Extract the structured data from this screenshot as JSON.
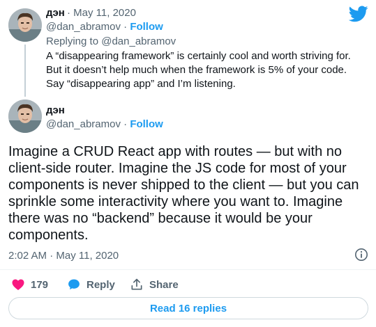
{
  "colors": {
    "accent": "#1d9bf0",
    "muted": "#536471",
    "text": "#0f1419",
    "like": "#f91880"
  },
  "reply_tweet": {
    "author_name": "дэн",
    "date": "May 11, 2020",
    "handle": "@dan_abramov",
    "follow_label": "Follow",
    "replying_prefix": "Replying to",
    "replying_to": "@dan_abramov",
    "text": "A “disappearing framework” is certainly cool and worth striving for. But it doesn’t help much when the framework is 5% of your code. Say “disappearing app” and I’m listening."
  },
  "main_tweet": {
    "author_name": "дэн",
    "handle": "@dan_abramov",
    "follow_label": "Follow",
    "text": "Imagine a CRUD React app with routes — but with no client-side router. Imagine the JS code for most of your components is never shipped to the client — but you can sprinkle some interactivity where you want to. Imagine there was no “backend” because it would be your components.",
    "timestamp": "2:02 AM · May 11, 2020"
  },
  "actions": {
    "likes_count": "179",
    "reply_label": "Reply",
    "share_label": "Share"
  },
  "read_replies_label": "Read 16 replies",
  "icons": [
    "twitter-bird-icon",
    "info-icon",
    "heart-icon",
    "reply-bubble-icon",
    "share-icon"
  ]
}
